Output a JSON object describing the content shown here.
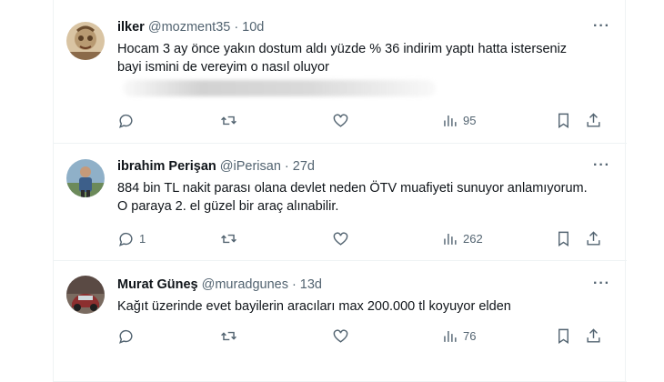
{
  "tweets": [
    {
      "name": "ilker",
      "handle": "@mozment35",
      "separator": "·",
      "time": "10d",
      "more": "···",
      "text": "Hocam 3 ay önce yakın dostum aldı yüzde %  36 indirim yaptı hatta isterseniz bayi ismini de vereyim o nasıl oluyor",
      "replies": "",
      "views": "95",
      "avatar_color": "#b89a72"
    },
    {
      "name": "ibrahim Perişan",
      "handle": "@iPerisan",
      "separator": "·",
      "time": "27d",
      "more": "···",
      "text": "884 bin TL nakit parası olana devlet neden ÖTV muafiyeti sunuyor anlamıyorum. O paraya 2. el güzel bir araç alınabilir.",
      "replies": "1",
      "views": "262",
      "avatar_color": "#4f7d9e"
    },
    {
      "name": "Murat Güneş",
      "handle": "@muradgunes",
      "separator": "·",
      "time": "13d",
      "more": "···",
      "text": "Kağıt üzerinde evet bayilerin aracıları max 200.000 tl koyuyor elden",
      "replies": "",
      "views": "76",
      "avatar_color": "#8c2f2f"
    }
  ],
  "icons": [
    "reply-icon",
    "retweet-icon",
    "like-icon",
    "views-icon",
    "bookmark-icon",
    "share-icon",
    "more-icon"
  ],
  "colors": {
    "text": "#0f1419",
    "secondary": "#536471",
    "divider": "#eff3f4"
  }
}
